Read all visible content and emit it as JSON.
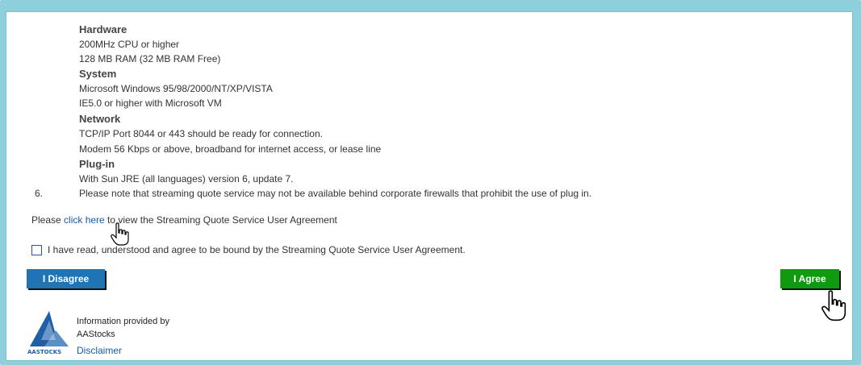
{
  "requirements": {
    "hardware_title": "Hardware",
    "hardware_lines": [
      "200MHz CPU or higher",
      "128 MB RAM (32 MB RAM Free)"
    ],
    "system_title": "System",
    "system_lines": [
      "Microsoft Windows 95/98/2000/NT/XP/VISTA",
      "IE5.0 or higher with Microsoft VM"
    ],
    "network_title": "Network",
    "network_lines": [
      "TCP/IP Port 8044 or 443 should be ready for connection.",
      "Modem 56 Kbps or above, broadband for internet access, or lease line"
    ],
    "plugin_title": "Plug-in",
    "plugin_lines": [
      "With Sun JRE (all languages) version 6, update 7."
    ]
  },
  "note": {
    "number": "6.",
    "text": "Please note that streaming quote service may not be available behind corporate firewalls that prohibit the use of plug in."
  },
  "agreement": {
    "prefix": "Please ",
    "link": "click here",
    "suffix": " to view the Streaming Quote Service User Agreement",
    "checkbox_label": "I have read, understood and agree to be bound by the Streaming Quote Service User Agreement.",
    "checked": false
  },
  "buttons": {
    "disagree": "I Disagree",
    "agree": "I Agree"
  },
  "footer": {
    "info_line1": "Information provided by",
    "info_line2": "AAStocks",
    "logo_text": "AASTOCKS",
    "disclaimer": "Disclaimer"
  },
  "colors": {
    "frame": "#8fcfdc",
    "link": "#1a5aa8",
    "disagree_button": "#1f74b5",
    "agree_button": "#109a10"
  },
  "icons": {
    "cursor": "hand-pointer-icon",
    "logo": "aastocks-logo"
  }
}
